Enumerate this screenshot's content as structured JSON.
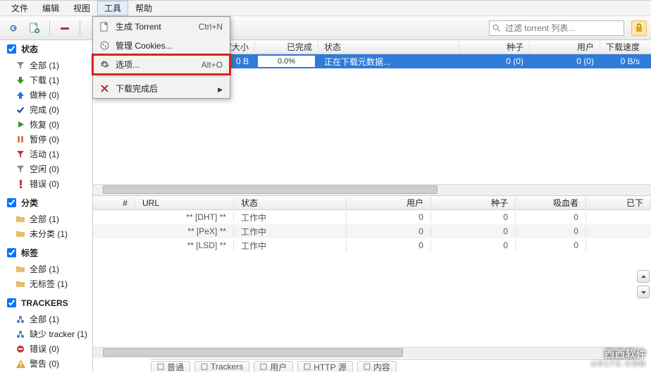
{
  "menu": {
    "items": [
      "文件",
      "编辑",
      "视图",
      "工具",
      "帮助"
    ],
    "open_index": 3
  },
  "tools_menu": {
    "items": [
      {
        "icon": "file-icon",
        "label": "生成 Torrent",
        "shortcut": "Ctrl+N",
        "submenu": false
      },
      {
        "icon": "cookie-icon",
        "label": "管理 Cookies...",
        "shortcut": "",
        "submenu": false
      },
      {
        "icon": "gear-icon",
        "label": "选项...",
        "shortcut": "Alt+O",
        "submenu": false,
        "highlight": true
      },
      {
        "sep": true
      },
      {
        "icon": "close-icon",
        "label": "下载完成后",
        "shortcut": "",
        "submenu": true
      }
    ]
  },
  "toolbar": {
    "buttons": [
      "open-file",
      "add-link",
      "remove",
      "play",
      "pause"
    ],
    "search_placeholder": "过滤 torrent 列表..."
  },
  "sidebar": {
    "groups": [
      {
        "title": "状态",
        "checked": true,
        "items": [
          {
            "icon": "filter-icon",
            "color": "#888",
            "label": "全部 (1)"
          },
          {
            "icon": "down-icon",
            "color": "#2a9a2a",
            "label": "下载 (1)"
          },
          {
            "icon": "up-icon",
            "color": "#2a6fd6",
            "label": "做种 (0)"
          },
          {
            "icon": "check-icon",
            "color": "#1e3da8",
            "label": "完成 (0)"
          },
          {
            "icon": "play-icon",
            "color": "#2a9a2a",
            "label": "恢复 (0)"
          },
          {
            "icon": "pause-icon",
            "color": "#e07a4a",
            "label": "暂停 (0)"
          },
          {
            "icon": "funnel-icon",
            "color": "#c23a3a",
            "label": "活动 (1)"
          },
          {
            "icon": "funnel-icon",
            "color": "#888",
            "label": "空闲 (0)"
          },
          {
            "icon": "error-icon",
            "color": "#c23a3a",
            "label": "错误 (0)"
          }
        ]
      },
      {
        "title": "分类",
        "checked": true,
        "items": [
          {
            "icon": "folder-icon",
            "color": "#e0a43a",
            "label": "全部 (1)"
          },
          {
            "icon": "folder-icon",
            "color": "#e0a43a",
            "label": "未分类 (1)"
          }
        ]
      },
      {
        "title": "标签",
        "checked": true,
        "items": [
          {
            "icon": "folder-icon",
            "color": "#e0a43a",
            "label": "全部 (1)"
          },
          {
            "icon": "folder-icon",
            "color": "#e0a43a",
            "label": "无标签 (1)"
          }
        ]
      },
      {
        "title": "TRACKERS",
        "checked": true,
        "items": [
          {
            "icon": "network-icon",
            "color": "#4a7dc0",
            "label": "全部 (1)"
          },
          {
            "icon": "network-icon",
            "color": "#4a7dc0",
            "label": "缺少 tracker (1)"
          },
          {
            "icon": "stop-icon",
            "color": "#c23a3a",
            "label": "错误 (0)"
          },
          {
            "icon": "warn-icon",
            "color": "#e0a43a",
            "label": "警告 (0)"
          }
        ]
      }
    ]
  },
  "torrent_table": {
    "headers": [
      "选定大小",
      "已完成",
      "状态",
      "种子",
      "用户",
      "下载速度"
    ],
    "rows": [
      {
        "size": "0 B",
        "done_pct": "0.0%",
        "status": "正在下载元数据...",
        "seeds": "0 (0)",
        "peers": "0 (0)",
        "dlspeed": "0 B/s",
        "selected": true
      }
    ]
  },
  "trackers_table": {
    "headers": [
      "#",
      "URL",
      "状态",
      "用户",
      "种子",
      "吸血者",
      "已下"
    ],
    "header_last_truncated": "已下",
    "rows": [
      {
        "num": "",
        "url": "** [DHT] **",
        "status": "工作中",
        "peers": "0",
        "seeds": "0",
        "leech": "0",
        "done": ""
      },
      {
        "num": "",
        "url": "** [PeX] **",
        "status": "工作中",
        "peers": "0",
        "seeds": "0",
        "leech": "0",
        "done": ""
      },
      {
        "num": "",
        "url": "** [LSD] **",
        "status": "工作中",
        "peers": "0",
        "seeds": "0",
        "leech": "0",
        "done": ""
      }
    ]
  },
  "bottom_tabs": [
    "普通",
    "Trackers",
    "用户",
    "HTTP 源",
    "内容"
  ],
  "watermark": {
    "line1": "西西软件",
    "line2": "CR173.COM"
  }
}
